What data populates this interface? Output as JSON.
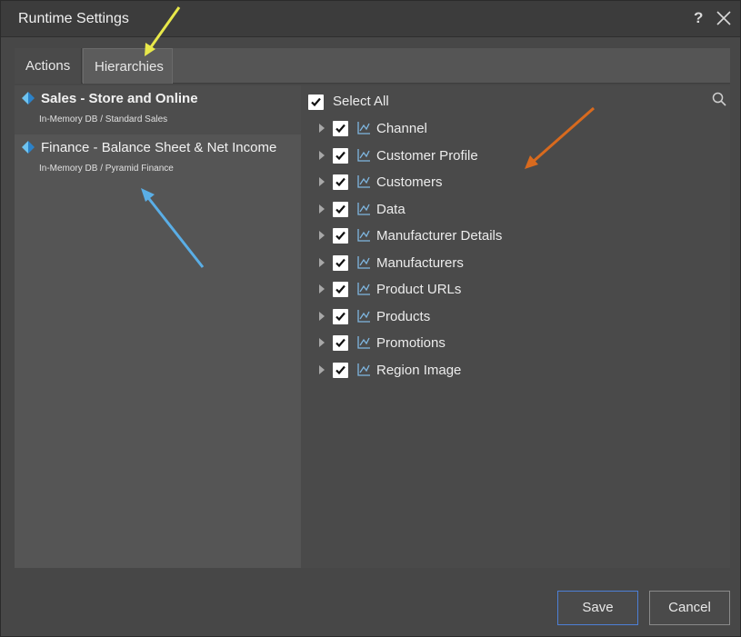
{
  "dialog": {
    "title": "Runtime Settings",
    "help_label": "?"
  },
  "tabs": [
    {
      "label": "Actions",
      "active": false
    },
    {
      "label": "Hierarchies",
      "active": true
    }
  ],
  "models": [
    {
      "name": "Sales - Store and Online",
      "sub": "In-Memory DB / Standard Sales",
      "selected": true
    },
    {
      "name": "Finance - Balance Sheet & Net Income",
      "sub": "In-Memory DB / Pyramid Finance",
      "selected": false
    }
  ],
  "hierarchies": {
    "select_all_label": "Select All",
    "items": [
      {
        "label": "Channel",
        "checked": true
      },
      {
        "label": "Customer Profile",
        "checked": true
      },
      {
        "label": "Customers",
        "checked": true
      },
      {
        "label": "Data",
        "checked": true
      },
      {
        "label": "Manufacturer Details",
        "checked": true
      },
      {
        "label": "Manufacturers",
        "checked": true
      },
      {
        "label": "Product URLs",
        "checked": true
      },
      {
        "label": "Products",
        "checked": true
      },
      {
        "label": "Promotions",
        "checked": true
      },
      {
        "label": "Region Image",
        "checked": true
      }
    ]
  },
  "buttons": {
    "save_label": "Save",
    "cancel_label": "Cancel"
  },
  "colors": {
    "accent_blue": "#4d7fd6",
    "model_icon_light": "#6ec3f0",
    "model_icon_dark": "#2b82c9",
    "annotation_yellow": "#e8e84a",
    "annotation_blue": "#5aaee6",
    "annotation_orange": "#d86a1e"
  },
  "icons": {
    "close": "close-icon",
    "search": "search-icon",
    "model": "model-diamond-icon",
    "hierarchy": "hierarchy-icon",
    "expander": "chevron-right-icon"
  }
}
